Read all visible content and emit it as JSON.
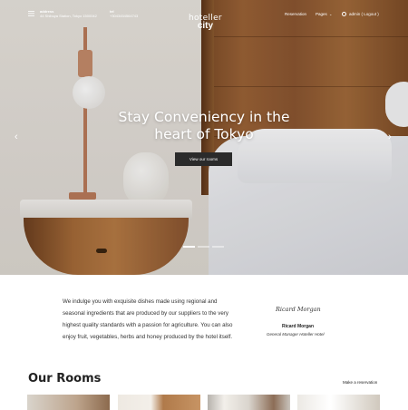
{
  "header": {
    "address_label": "address",
    "address_value": "44 Shibuya Station, Tokyo 1500042",
    "tel_label": "tel",
    "tel_value": "+3043454564743",
    "logo_line1": "hoteller",
    "logo_line2": "city",
    "nav": {
      "reservation": "Reservation",
      "pages": "Pages",
      "user": "admin ( Logout )"
    },
    "icons": {
      "menu": "hamburger-menu-icon",
      "user": "user-icon",
      "pages_dropdown": "chevron-down-icon"
    }
  },
  "hero": {
    "title": "Stay Conveniency in the heart of Tokyo",
    "button": "View our rooms",
    "prev_arrow": "‹",
    "next_arrow": "›",
    "slide_count": 3,
    "active_slide": 1
  },
  "intro": {
    "text": "We indulge you with exquisite dishes made using regional and seasonal ingredients that are produced by our suppliers to the very highest quality standards with a passion for agriculture. You can also enjoy fruit, vegetables, herbs and honey produced by the hotel itself.",
    "signature": "Ricard Morgan",
    "name": "Ricard Morgan",
    "role": "General Manager Hoteller Hotel"
  },
  "rooms": {
    "title": "Our Rooms",
    "make_reservation": "Make a reservation"
  }
}
